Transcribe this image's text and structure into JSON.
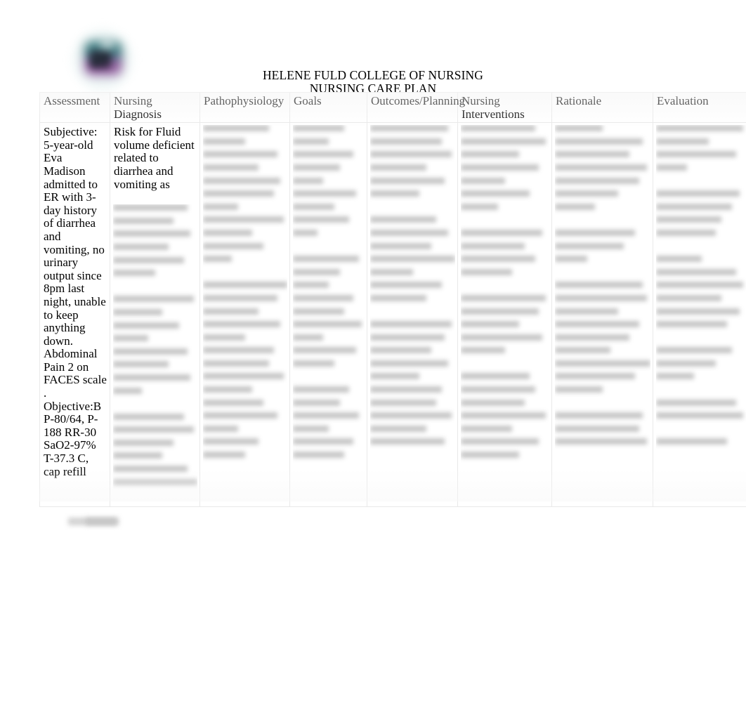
{
  "document": {
    "title_line1": "HELENE FULD COLLEGE OF NURSING",
    "title_line2": "NURSING CARE PLAN",
    "logo_alt": "college-logo"
  },
  "table": {
    "headers": [
      "Assessment",
      "Nursing Diagnosis",
      "Pathophysiology",
      "Goals",
      "Outcomes/Planning",
      "Nursing Interventions",
      "Rationale",
      "Evaluation"
    ],
    "row": {
      "assessment": "Subjective: 5-year-old Eva Madison admitted to ER with 3-day history of diarrhea and vomiting, no urinary output since 8pm last night, unable to keep anything down. Abdominal Pain 2 on FACES scale  . Objective:BP-80/64, P-188 RR-30 SaO2-97% T-37.3 C, cap refill",
      "nursing_diagnosis": " Risk for Fluid volume deficient related to diarrhea and vomiting as",
      "pathophysiology": "",
      "goals": "",
      "outcomes_planning": "",
      "nursing_interventions": "",
      "rationale": "",
      "evaluation": ""
    }
  },
  "redacted": {
    "note": "blurred-illegible-content"
  }
}
